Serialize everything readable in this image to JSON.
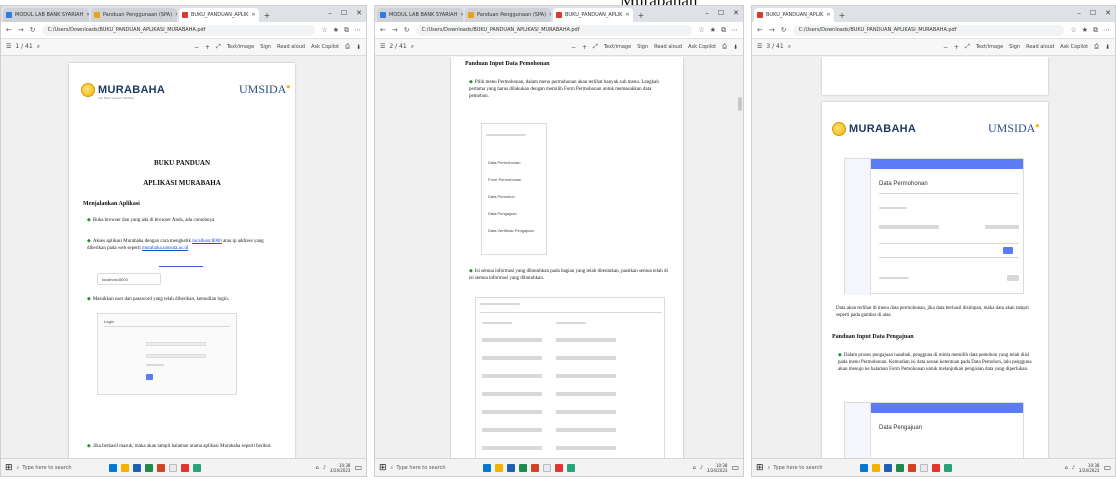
{
  "caption": "Murabahah",
  "colors": {
    "accent": "#5b7cf5",
    "link": "#1a4fd0",
    "bullet": "#1b8f3a",
    "tab_bar": "#dee1e6"
  },
  "windows": [
    {
      "tabs": [
        "MODUL LAB BANK SYARIAH",
        "Panduan Penggunaan (SPA)",
        "BUKU_PANDUAN_APLIK"
      ],
      "url": "C:/Users/Downloads/BUKU_PANDUAN_APLIKASI_MURABAHA.pdf",
      "page_indicator": "1 / 41",
      "tools": [
        "Text/image",
        "Sign",
        "Read aloud",
        "Ask Copilot"
      ],
      "search_placeholder": "Type here to search",
      "clock_time": "10:38",
      "clock_date": "3/24/2023"
    },
    {
      "tabs": [
        "MODUL LAB BANK SYARIAH",
        "Panduan Penggunaan (SPA)",
        "BUKU_PANDUAN_APLIK"
      ],
      "url": "C:/Users/Downloads/BUKU_PANDUAN_APLIKASI_MURABAHA.pdf",
      "page_indicator": "2 / 41",
      "tools": [
        "Text/image",
        "Sign",
        "Read aloud",
        "Ask Copilot"
      ],
      "search_placeholder": "Type here to search",
      "clock_time": "10:38",
      "clock_date": "3/24/2023"
    },
    {
      "tabs": [
        "BUKU_PANDUAN_APLIK"
      ],
      "url": "C:/Users/Downloads/BUKU_PANDUAN_APLIKASI_MURABAHA.pdf",
      "page_indicator": "3 / 41",
      "tools": [
        "Text/image",
        "Sign",
        "Read aloud",
        "Ask Copilot"
      ],
      "search_placeholder": "Type here to search",
      "clock_time": "10:38",
      "clock_date": "3/24/2023"
    }
  ],
  "doc1": {
    "brand": "MURABAHA",
    "brand_sub": "Lab Bank Syariah UMSIDA",
    "partner": "UMSIDA",
    "title_1": "BUKU PANDUAN",
    "title_2": "APLIKASI MURABAHA",
    "heading": "Menjalankan Aplikasi",
    "p1": "Buka browser dan yang ada di browser Anda, ada contohnya",
    "p2_a": "Akses aplikasi Murabaha dengan cara mengketik",
    "p2_link": "localhost:8000",
    "p2_b": "atau ip address yang diberikan pada web seperti",
    "p2_link2": "murabaha.umsida.ac.id",
    "url_box": "localhost:8000",
    "p3": "Masukkan user dan password yang telah diberikan, kemudian login.",
    "login_label": "Login",
    "p4": "Jika berhasil masuk, maka akan tampil halaman utama aplikasi Murabaha seperti berikut."
  },
  "doc2": {
    "heading": "Panduan Input Data Pemohonan",
    "p1": "Pilih menu Permohonan, dalam menu permohonan akan terlihat banyak sub menu. Langkah pertama yang harus dilakukan dengan memilih Form Permohonan untuk memasukkan data pemohon.",
    "menu_items": [
      "Data Permohonan",
      "Form Permohonan",
      "Data Pemohon",
      "Data Pengajuan",
      "Data Verifikasi Pengajuan"
    ],
    "p2": "Isi semua informasi yang dibutuhkan pada bagian yang telah ditentukan, pastikan semua telah di isi semua informasi yang dibutuhkan."
  },
  "doc3": {
    "brand": "MURABAHA",
    "partner": "UMSIDA",
    "section_title": "Data Permohonan",
    "p1": "Data akan terlihat di menu data permohonan, jika data berhasil disimpan, maka data akan tampil seperti pada gambar di atas.",
    "heading": "Panduan Input Data Pengajuan",
    "p2": "Dalam proses pengajuan nasabah, pengguna di minta memilih data pemohon yang telah diisi pada menu Permohonan. Kemudian isi data sesuai ketentuan pada Data Pemohon, lalu pengguna akan menuju ke halaman Form Pemohonan untuk melanjutkan pengisian data yang diperlukan.",
    "section_title_2": "Data Pengajuan"
  }
}
